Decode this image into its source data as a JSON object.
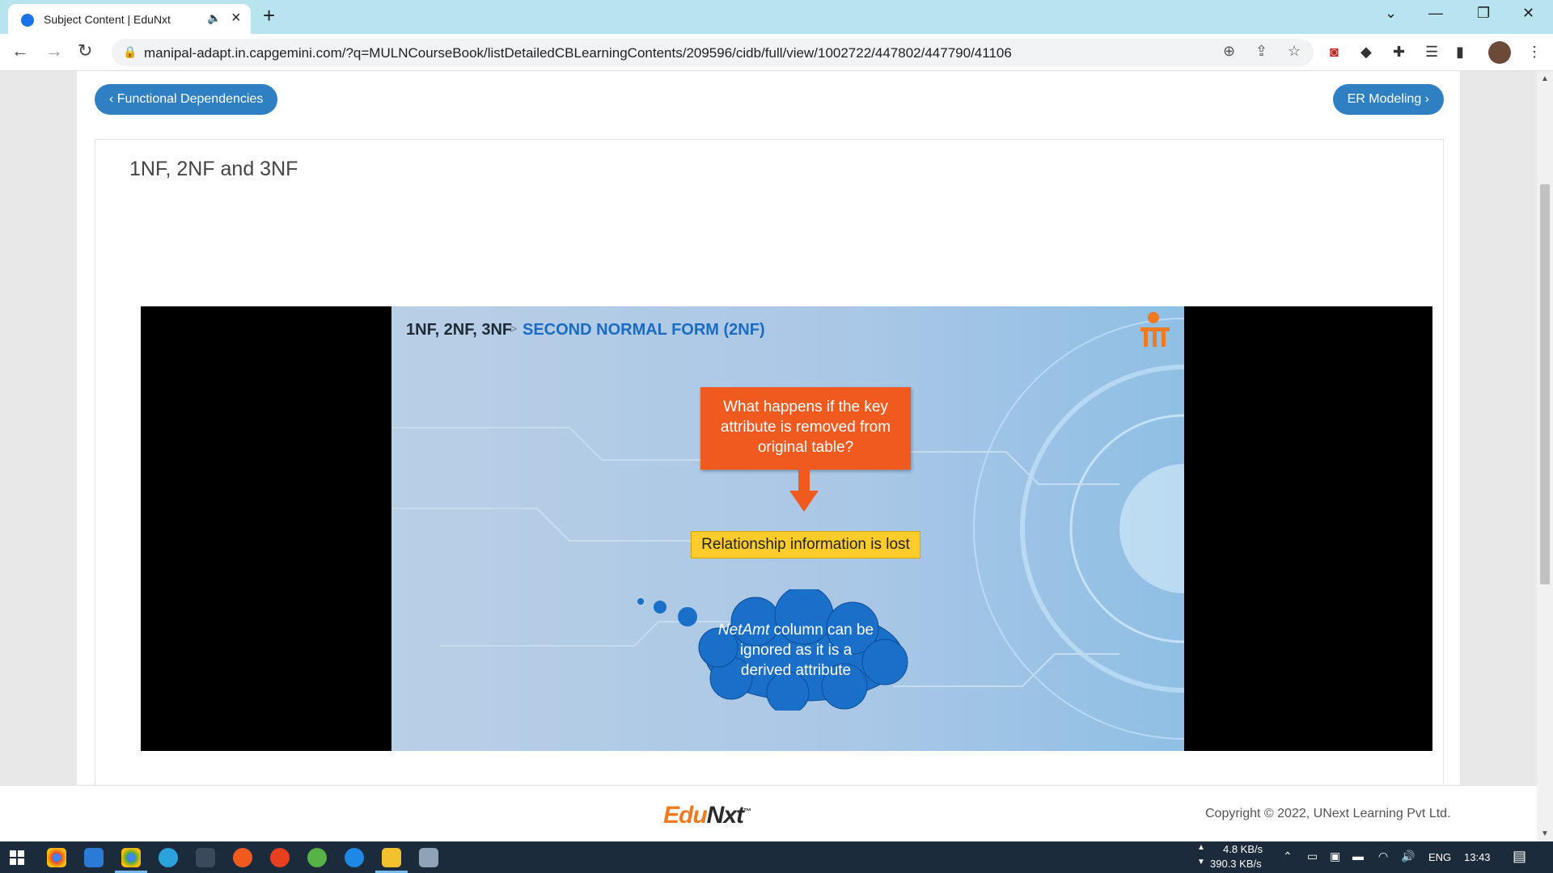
{
  "browser": {
    "tab_title": "Subject Content | EduNxt",
    "url": "manipal-adapt.in.capgemini.com/?q=MULNCourseBook/listDetailedCBLearningContents/209596/cidb/full/view/1002722/447802/447790/41106",
    "icons": [
      "back-icon",
      "forward-icon",
      "reload-icon",
      "lock-icon",
      "zoom-icon",
      "share-icon",
      "star-icon",
      "extensions-icon",
      "reading-list-icon",
      "side-panel-icon",
      "menu-icon"
    ]
  },
  "nav": {
    "prev_label": "‹ Functional Dependencies",
    "next_label": "ER Modeling ›"
  },
  "lesson": {
    "title": "1NF, 2NF and 3NF"
  },
  "slide": {
    "heading_part1": "1NF, 2NF, 3NF",
    "heading_sep": ">",
    "heading_part2": "SECOND NORMAL FORM (2NF)",
    "question": "What happens if the key attribute is removed from original table?",
    "answer": "Relationship information is lost",
    "thought_italic": "NetAmt",
    "thought_rest": " column can be ignored as it is a derived attribute"
  },
  "footer": {
    "logo_edu": "Edu",
    "logo_nxt": "Nxt",
    "logo_tm": "™",
    "copyright": "Copyright © 2022, UNext Learning Pvt Ltd."
  },
  "taskbar": {
    "net_up": "4.8 KB/s",
    "net_down": "390.3 KB/s",
    "lang": "ENG",
    "time": "13:43"
  },
  "colors": {
    "accent": "#2f80c2",
    "question_bg": "#f05a1e",
    "answer_bg": "#ffcc2c",
    "cloud": "#1a6fc9"
  }
}
